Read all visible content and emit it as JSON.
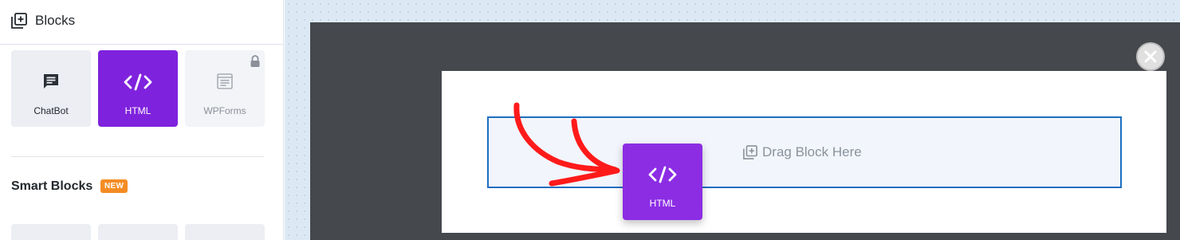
{
  "sidebar": {
    "header": {
      "title": "Blocks",
      "icon": "add-block-icon"
    },
    "blocks": [
      {
        "label": "ChatBot",
        "icon": "chat-icon",
        "state": "default"
      },
      {
        "label": "HTML",
        "icon": "code-icon",
        "state": "active"
      },
      {
        "label": "WPForms",
        "icon": "form-icon",
        "state": "locked"
      }
    ],
    "smart_blocks": {
      "title": "Smart Blocks",
      "badge": "NEW"
    }
  },
  "canvas": {
    "drop_zone_label": "Drag Block Here",
    "dragged_block": {
      "label": "HTML",
      "icon": "code-icon"
    },
    "close_icon": "close-icon"
  },
  "colors": {
    "accent_purple": "#7f22dd",
    "badge_orange": "#f48c23",
    "drop_border_blue": "#1e6ec0",
    "arrow_red": "#ff1a1a",
    "overlay_dark": "#45484d"
  }
}
